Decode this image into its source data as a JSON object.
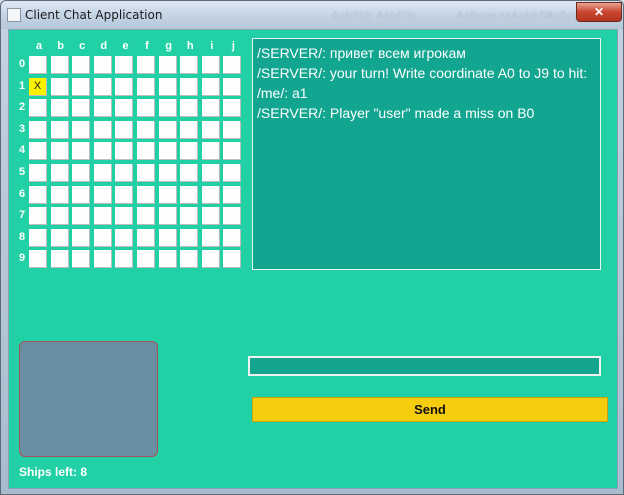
{
  "window": {
    "title": "Client Chat Application",
    "close_glyph": "✕",
    "ghost_text": [
      "Aabfillb Aabfillb",
      "Ааборвлв",
      "Aabbfilt",
      "Ааборвлв"
    ]
  },
  "board": {
    "columns": [
      "a",
      "b",
      "c",
      "d",
      "e",
      "f",
      "g",
      "h",
      "i",
      "j"
    ],
    "rows": [
      "0",
      "1",
      "2",
      "3",
      "4",
      "5",
      "6",
      "7",
      "8",
      "9"
    ],
    "marks": [
      {
        "row": 1,
        "col": 0,
        "text": "X",
        "color": "#fbf200"
      }
    ]
  },
  "chat": {
    "messages": [
      "/SERVER/: привет всем игрокам",
      "/SERVER/: your turn! Write coordinate A0 to J9 to hit:",
      "/me/: a1",
      "/SERVER/: Player \"user\" made a miss on B0"
    ]
  },
  "input": {
    "value": ""
  },
  "send_button": {
    "label": "Send"
  },
  "ships_left": "Ships left: 8",
  "colors": {
    "background": "#21d0a4",
    "chat_bg": "#12a590",
    "send": "#f5cd0e",
    "avatar": "#698fa2"
  }
}
